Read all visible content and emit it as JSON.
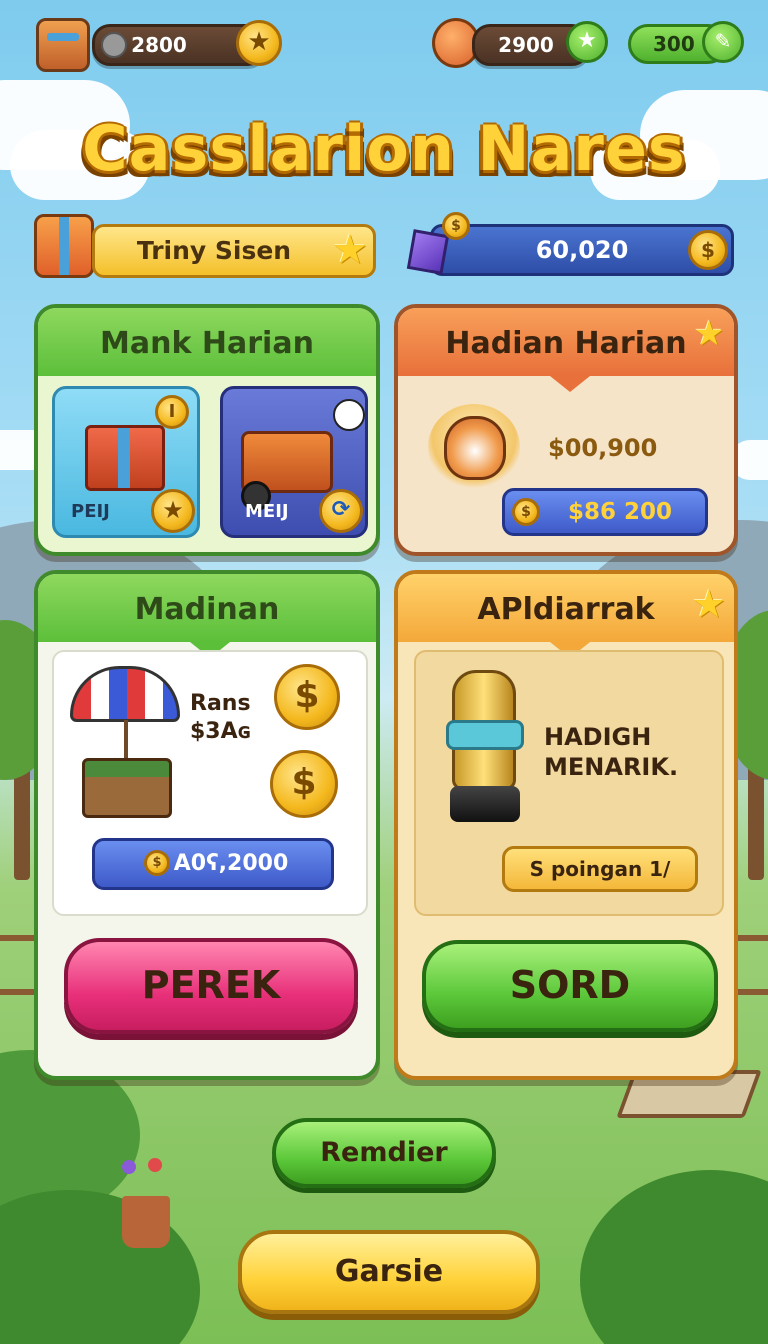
{
  "header": {
    "resource_1": {
      "value": "2800",
      "icon": "backpack-icon",
      "badge_icon": "star-icon"
    },
    "resource_2": {
      "value": "2900",
      "icon": "sun-icon",
      "badge_icon": "star-icon"
    },
    "resource_3": {
      "value": "300",
      "badge_icon": "pencil-icon"
    }
  },
  "title": "Casslarion Nares",
  "player_bar": {
    "name": "Triny Sisen",
    "icon": "gift-icon",
    "star_icon": "star-icon"
  },
  "currency_bar": {
    "value": "60,020",
    "gem_icon": "purple-gem-icon",
    "coin_icon": "dollar-coin-icon"
  },
  "panel_mank": {
    "title": "Mank Harian",
    "tiles": [
      {
        "label": "PEIJ",
        "icon": "gift-box-icon",
        "badge_icon": "star-icon",
        "corner_badge": "I"
      },
      {
        "label": "MEIJ",
        "icon": "cart-icon",
        "badge_icon": "refresh-icon"
      }
    ]
  },
  "panel_hadiah": {
    "title": "Hadian Harian",
    "amount": "$00,900",
    "pill_value": "$86 200",
    "icon": "hamster-icon"
  },
  "panel_madinan": {
    "title": "Madinan",
    "label_line1": "Rans",
    "label_line2": "$3Aɢ",
    "pill_value": "A0ʕ,2000",
    "button": "PEREK",
    "icons": [
      "umbrella-stall-icon",
      "dollar-coin-icon"
    ]
  },
  "panel_apldiarrak": {
    "title": "APldiarrak",
    "text_line1": "HADIGH",
    "text_line2": "MENARIK.",
    "pill_value": "S poingan 1/",
    "button": "SORD",
    "icon": "trophy-icon"
  },
  "bottom_buttons": {
    "remdier": "Remdier",
    "garsie": "Garsie"
  },
  "colors": {
    "green_accent": "#5cbf3a",
    "orange_accent": "#f08a3a",
    "pink_button": "#f04a86",
    "yellow_button": "#ffd23a",
    "blue_pill": "#4a6fd8"
  }
}
